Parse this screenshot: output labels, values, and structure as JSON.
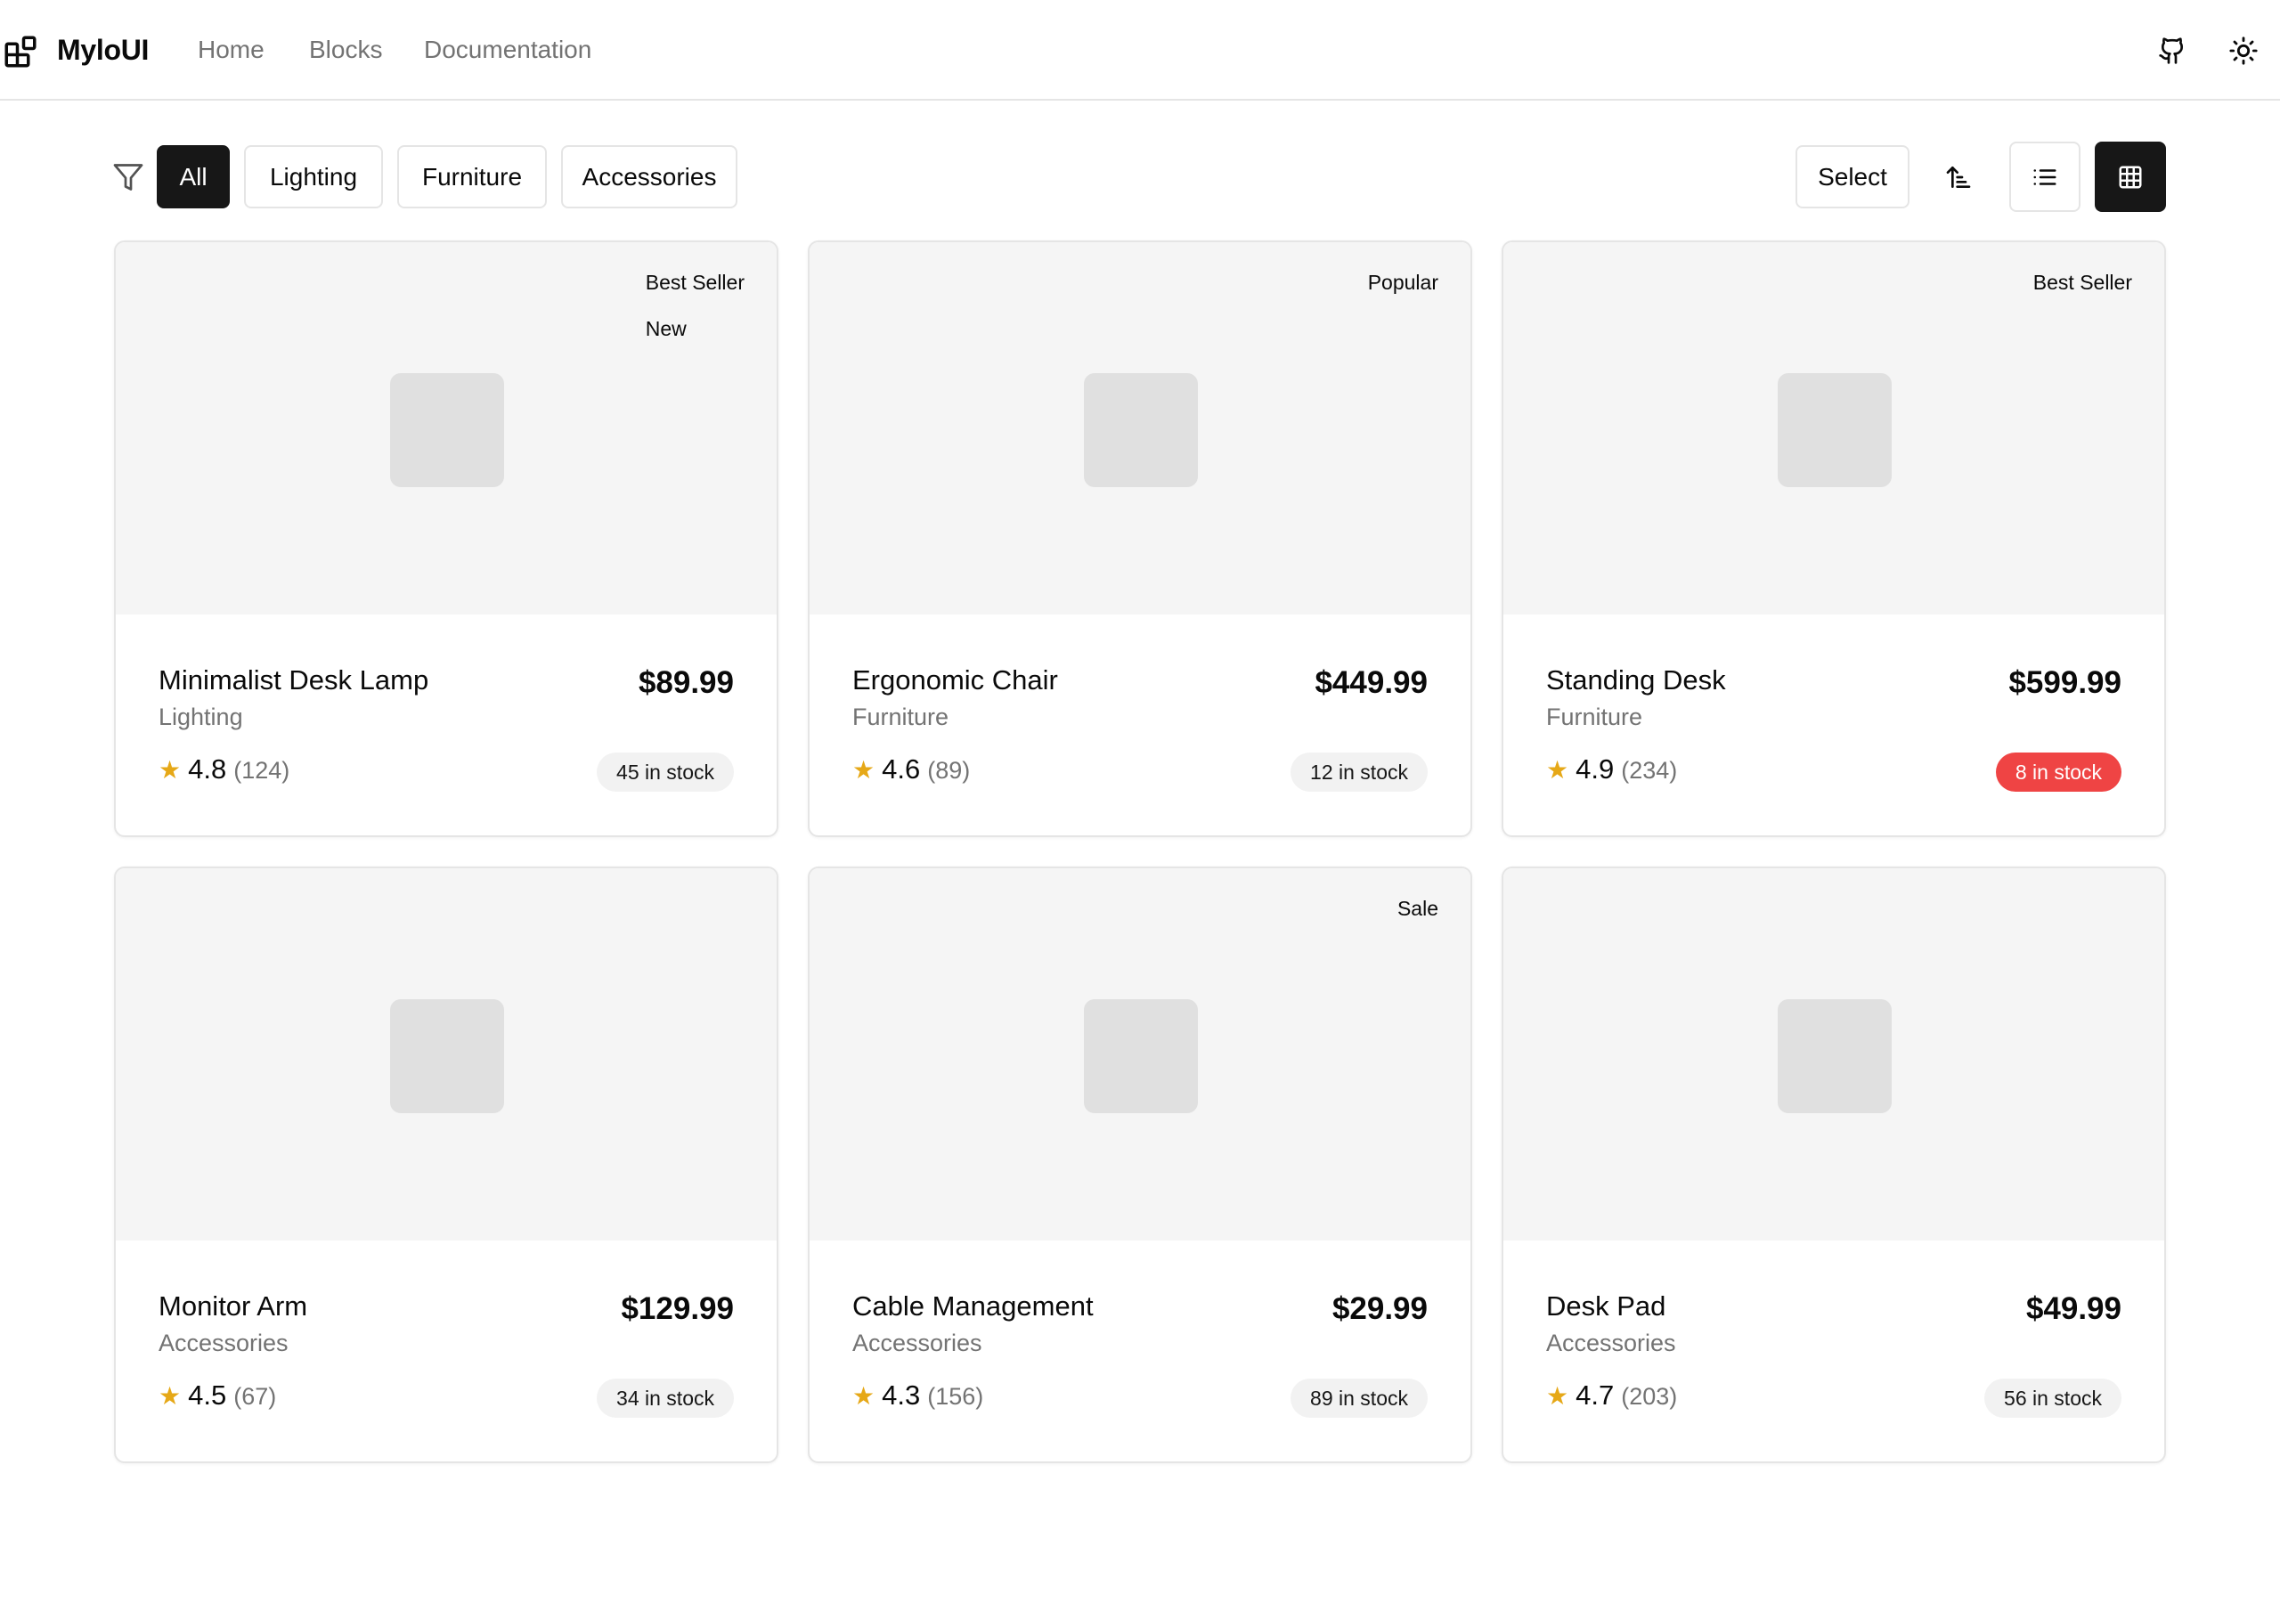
{
  "header": {
    "brand": "MyloUI",
    "nav": [
      "Home",
      "Blocks",
      "Documentation"
    ]
  },
  "filters": {
    "chips": [
      "All",
      "Lighting",
      "Furniture",
      "Accessories"
    ],
    "active": "All"
  },
  "toolbar": {
    "select_label": "Select",
    "view_mode": "grid"
  },
  "colors": {
    "primary": "#171717",
    "star": "#e6a817",
    "low_stock": "#ef4444",
    "muted_text": "#737373",
    "card_media_bg": "#f5f5f5"
  },
  "products": [
    {
      "name": "Minimalist Desk Lamp",
      "category": "Lighting",
      "price": "$89.99",
      "rating": "4.8",
      "reviews": "(124)",
      "stock": "45 in stock",
      "low_stock": false,
      "badges": [
        "Best Seller",
        "New"
      ]
    },
    {
      "name": "Ergonomic Chair",
      "category": "Furniture",
      "price": "$449.99",
      "rating": "4.6",
      "reviews": "(89)",
      "stock": "12 in stock",
      "low_stock": false,
      "badges": [
        "Popular"
      ]
    },
    {
      "name": "Standing Desk",
      "category": "Furniture",
      "price": "$599.99",
      "rating": "4.9",
      "reviews": "(234)",
      "stock": "8 in stock",
      "low_stock": true,
      "badges": [
        "Best Seller"
      ]
    },
    {
      "name": "Monitor Arm",
      "category": "Accessories",
      "price": "$129.99",
      "rating": "4.5",
      "reviews": "(67)",
      "stock": "34 in stock",
      "low_stock": false,
      "badges": []
    },
    {
      "name": "Cable Management",
      "category": "Accessories",
      "price": "$29.99",
      "rating": "4.3",
      "reviews": "(156)",
      "stock": "89 in stock",
      "low_stock": false,
      "badges": [
        "Sale"
      ]
    },
    {
      "name": "Desk Pad",
      "category": "Accessories",
      "price": "$49.99",
      "rating": "4.7",
      "reviews": "(203)",
      "stock": "56 in stock",
      "low_stock": false,
      "badges": []
    }
  ]
}
